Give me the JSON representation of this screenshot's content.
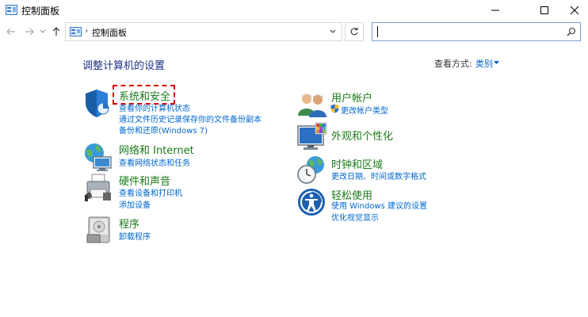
{
  "window": {
    "title": "控制面板"
  },
  "address": {
    "breadcrumb": "控制面板",
    "separator": "›"
  },
  "search": {
    "value": ""
  },
  "main": {
    "heading": "调整计算机的设置",
    "view_by_label": "查看方式:",
    "view_by_value": "类别"
  },
  "categories": {
    "security": {
      "title": "系统和安全",
      "links": [
        "查看你的计算机状态",
        "通过文件历史记录保存你的文件备份副本",
        "备份和还原(Windows 7)"
      ]
    },
    "network": {
      "title": "网络和 Internet",
      "links": [
        "查看网络状态和任务"
      ]
    },
    "hardware": {
      "title": "硬件和声音",
      "links": [
        "查看设备和打印机",
        "添加设备"
      ]
    },
    "programs": {
      "title": "程序",
      "links": [
        "卸载程序"
      ]
    },
    "accounts": {
      "title": "用户帐户",
      "links": [
        "更改帐户类型"
      ]
    },
    "appearance": {
      "title": "外观和个性化",
      "links": []
    },
    "clock": {
      "title": "时钟和区域",
      "links": [
        "更改日期、时间或数字格式"
      ]
    },
    "ease": {
      "title": "轻松使用",
      "links": [
        "使用 Windows 建议的设置",
        "优化视觉显示"
      ]
    }
  },
  "icons": {
    "app": "control-panel-icon",
    "back": "arrow-left-icon",
    "forward": "arrow-right-icon",
    "up": "arrow-up-icon",
    "refresh": "refresh-icon",
    "search": "search-icon"
  },
  "colors": {
    "link": "#0066cc",
    "category_title": "#1a7a1a",
    "heading": "#1e3287",
    "highlight": "#e00000"
  }
}
